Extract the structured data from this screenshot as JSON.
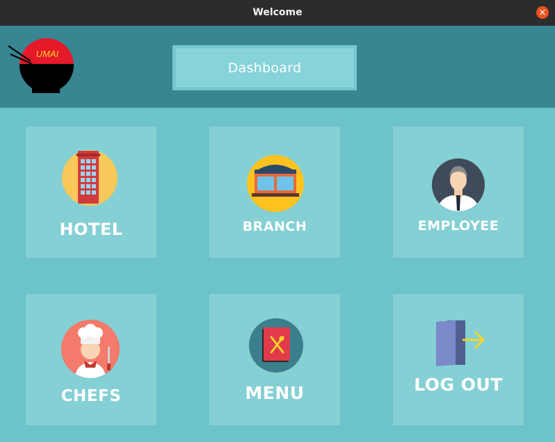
{
  "window": {
    "title": "Welcome",
    "close_glyph": "×"
  },
  "header": {
    "logo_text": "UMAI",
    "dashboard_label": "Dashboard",
    "colors": {
      "header_bg": "#378692",
      "page_bg": "#6cc3ca",
      "tile_bg": "#84d0d4"
    }
  },
  "tiles": [
    {
      "label": "HOTEL",
      "icon": "hotel-phonebooth-icon"
    },
    {
      "label": "BRANCH",
      "icon": "branch-storefront-icon"
    },
    {
      "label": "EMPLOYEE",
      "icon": "employee-person-icon"
    },
    {
      "label": "CHEFS",
      "icon": "chef-icon"
    },
    {
      "label": "MENU",
      "icon": "menu-book-icon"
    },
    {
      "label": "LOG OUT",
      "icon": "logout-door-icon"
    }
  ]
}
